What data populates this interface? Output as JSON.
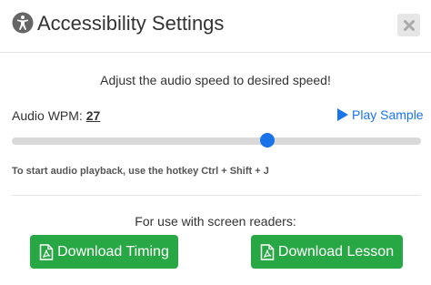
{
  "header": {
    "title": "Accessibility Settings",
    "icon": "accessibility-icon",
    "close_icon": "close-icon"
  },
  "instructions": "Adjust the audio speed to desired speed!",
  "audio": {
    "wpm_label": "Audio WPM:",
    "wpm_value": "27",
    "play_label": "Play Sample",
    "slider_fraction": 0.625
  },
  "hotkey_text": "To start audio playback, use the hotkey Ctrl + Shift + J",
  "screen_readers_text": "For use with screen readers:",
  "buttons": {
    "download_timing": "Download Timing",
    "download_lesson": "Download Lesson"
  },
  "colors": {
    "accent": "#1a73e8",
    "button_green": "#28a745"
  }
}
